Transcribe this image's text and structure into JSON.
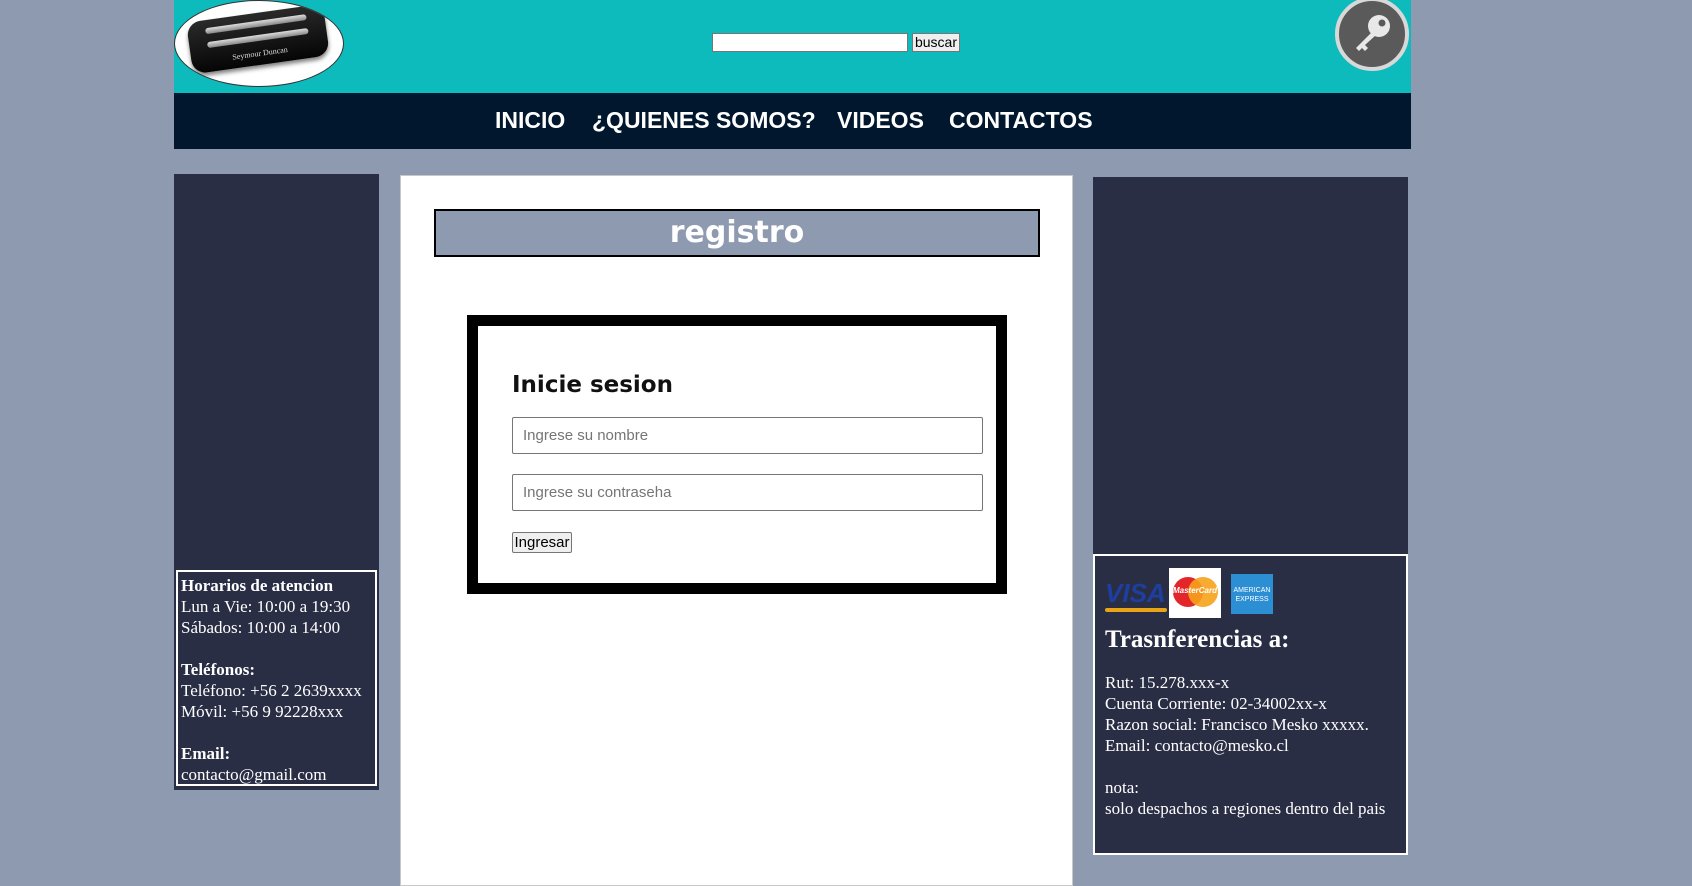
{
  "header": {
    "logo_brand": "Seymour Duncan",
    "search_placeholder": "",
    "search_button": "buscar",
    "key_icon": "key-icon",
    "colors": {
      "header_bg": "#0dbabc",
      "nav_bg": "#00172e",
      "page_bg": "#8e9ab0",
      "panel_bg": "#2a2e45"
    }
  },
  "nav": {
    "items": [
      {
        "label": "INICIO"
      },
      {
        "label": "¿QUIENES SOMOS?"
      },
      {
        "label": "VIDEOS"
      },
      {
        "label": "CONTACTOS"
      }
    ]
  },
  "left_sidebar": {
    "hours_title": "Horarios de atencion",
    "hours_weekdays": "Lun a Vie: 10:00 a 19:30",
    "hours_saturday": "Sábados: 10:00 a 14:00",
    "phones_title": "Teléfonos:",
    "phone": "Teléfono: +56 2 2639xxxx",
    "mobile": "Móvil: +56 9 92228xxx",
    "email_title": "Email:",
    "email": "contacto@gmail.com"
  },
  "main": {
    "title": "registro",
    "login": {
      "heading": "Inicie sesion",
      "name_placeholder": "Ingrese su nombre",
      "password_placeholder": "Ingrese su contraseha",
      "submit_label": "Ingresar"
    }
  },
  "right_sidebar": {
    "cards": {
      "visa": "VISA",
      "mastercard": "MasterCard",
      "amex": "AMERICAN EXPRESS"
    },
    "transfer_title": "Trasnferencias a:",
    "rut": "Rut: 15.278.xxx-x",
    "account": "Cuenta Corriente: 02-34002xx-x",
    "company": "Razon social: Francisco Mesko xxxxx.",
    "email": "Email: contacto@mesko.cl",
    "note_title": "nota:",
    "note": "solo despachos a regiones dentro del pais"
  }
}
